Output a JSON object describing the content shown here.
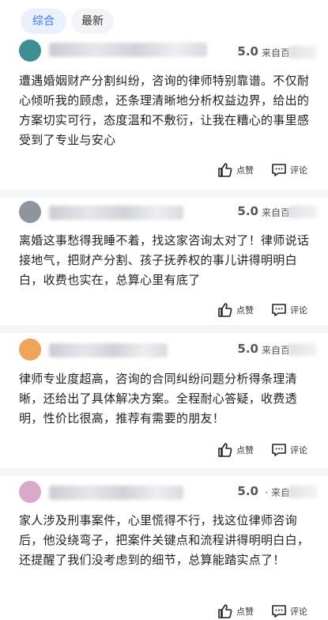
{
  "tabs": [
    {
      "label": "综合",
      "active": true
    },
    {
      "label": "最新",
      "active": false
    }
  ],
  "reviews": [
    {
      "score": "5.0",
      "source": "· 来自百",
      "avatar_color": "#3d8f93",
      "text": "遭遇婚姻财产分割纠纷，咨询的律师特别靠谱。不仅耐心倾听我的顾虑，还条理清晰地分析权益边界，给出的方案切实可行，态度温和不敷衍，让我在糟心的事里感受到了专业与安心",
      "like_label": "点赞",
      "comment_label": "评论"
    },
    {
      "score": "5.0",
      "source": "· 来自百",
      "avatar_color": "#8e959e",
      "text": "离婚这事愁得我睡不着，找这家咨询太对了！律师说话接地气，把财产分割、孩子抚养权的事儿讲得明明白白，收费也实在，总算心里有底了",
      "like_label": "点赞",
      "comment_label": "评论"
    },
    {
      "score": "5.0",
      "source": "· 来自百",
      "avatar_color": "#f0a45a",
      "text": "律师专业度超高，咨询的合同纠纷问题分析得条理清晰，还给出了具体解决方案。全程耐心答疑，收费透明，性价比很高，推荐有需要的朋友！",
      "like_label": "点赞",
      "comment_label": "评论"
    },
    {
      "score": "5.0",
      "source": "· 来自",
      "avatar_color": "#d9a9c9",
      "text": "家人涉及刑事案件，心里慌得不行，找这位律师咨询后，他没绕弯子，把案件关键点和流程讲得明明白白，还提醒了我们没考虑到的细节，总算能踏实点了！",
      "like_label": "点赞",
      "comment_label": "评论"
    }
  ]
}
